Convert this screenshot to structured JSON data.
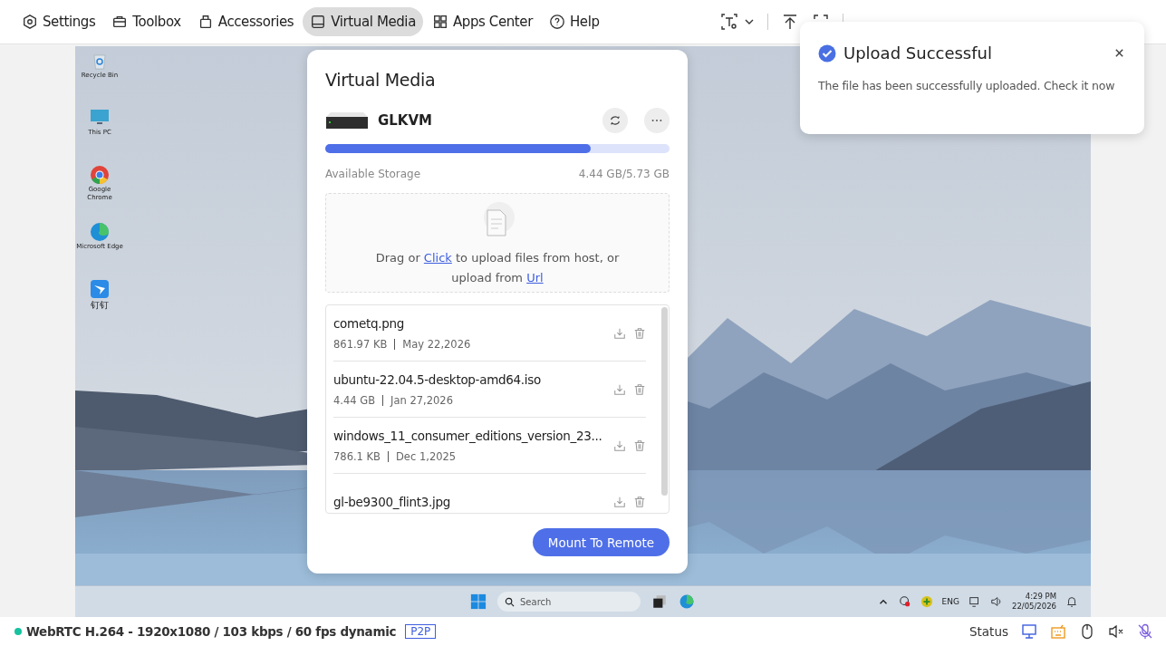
{
  "toolbar": {
    "tabs": [
      {
        "label": "Settings",
        "kind": "gear",
        "selected": false
      },
      {
        "label": "Toolbox",
        "kind": "toolbox",
        "selected": false
      },
      {
        "label": "Accessories",
        "kind": "accessory",
        "selected": false
      },
      {
        "label": "Virtual Media",
        "kind": "drive",
        "selected": true
      },
      {
        "label": "Apps Center",
        "kind": "apps",
        "selected": false
      },
      {
        "label": "Help",
        "kind": "help",
        "selected": false
      }
    ]
  },
  "desktop": {
    "icons": [
      {
        "label": "Recycle Bin",
        "kind": "recycle"
      },
      {
        "label": "This PC",
        "kind": "pc"
      },
      {
        "label": "Google Chrome",
        "kind": "chrome"
      },
      {
        "label": "Microsoft Edge",
        "kind": "edge"
      },
      {
        "label": "钉钉",
        "kind": "ding"
      }
    ],
    "taskbar": {
      "search_placeholder": "Search",
      "language": "ENG",
      "time": "4:29 PM",
      "date": "22/05/2026"
    }
  },
  "dialog": {
    "title": "Virtual Media",
    "device": "GLKVM",
    "storage": {
      "label": "Available Storage",
      "reading": "4.44 GB/5.73 GB",
      "level": 0.77
    },
    "upload": {
      "before": "Drag or ",
      "link1": "Click",
      "middle": " to upload files from host, or upload from ",
      "link2": "Url"
    },
    "files": [
      {
        "name": "cometq.png",
        "size": "861.97 KB",
        "date": "May 22,2026"
      },
      {
        "name": "ubuntu-22.04.5-desktop-amd64.iso",
        "size": "4.44 GB",
        "date": "Jan 27,2026"
      },
      {
        "name": "windows_11_consumer_editions_version_23...",
        "size": "786.1 KB",
        "date": "Dec 1,2025"
      },
      {
        "name": "gl-be9300_flint3.jpg"
      }
    ],
    "button": "Mount To Remote"
  },
  "toast": {
    "title": "Upload Successful",
    "message": "The file has been successfully uploaded. Check it now"
  },
  "status_bar": {
    "stream": "WebRTC H.264 - 1920x1080 / 103 kbps / 60 fps dynamic",
    "mode": "P2P",
    "status_label": "Status"
  }
}
